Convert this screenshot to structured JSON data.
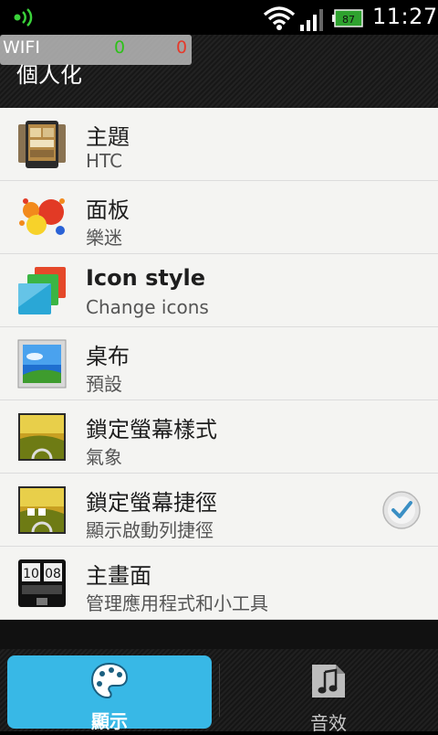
{
  "status_bar": {
    "time": "11:27",
    "battery_level": "87"
  },
  "wifi_overlay": {
    "label": "WIFI",
    "rx": "0",
    "tx": "0"
  },
  "header": {
    "title": "個人化"
  },
  "list": {
    "items": [
      {
        "title": "主題",
        "subtitle": "HTC",
        "icon": "theme-icon"
      },
      {
        "title": "面板",
        "subtitle": "樂迷",
        "icon": "skin-icon"
      },
      {
        "title": "Icon style",
        "subtitle": "Change icons",
        "icon": "icon-style-icon"
      },
      {
        "title": "桌布",
        "subtitle": "預設",
        "icon": "wallpaper-icon"
      },
      {
        "title": "鎖定螢幕樣式",
        "subtitle": "氣象",
        "icon": "lockscreen-style-icon"
      },
      {
        "title": "鎖定螢幕捷徑",
        "subtitle": "顯示啟動列捷徑",
        "icon": "lockscreen-shortcut-icon",
        "checked": true
      },
      {
        "title": "主畫面",
        "subtitle": "管理應用程式和小工具",
        "icon": "home-screen-icon",
        "clock_text": "10 08"
      }
    ]
  },
  "tabs": [
    {
      "label": "顯示",
      "icon": "palette-icon",
      "selected": true
    },
    {
      "label": "音效",
      "icon": "music-note-icon",
      "selected": false
    }
  ],
  "colors": {
    "accent": "#38b8e6",
    "list_bg": "#f4f4f2",
    "header_bg": "#1c1c1c"
  }
}
